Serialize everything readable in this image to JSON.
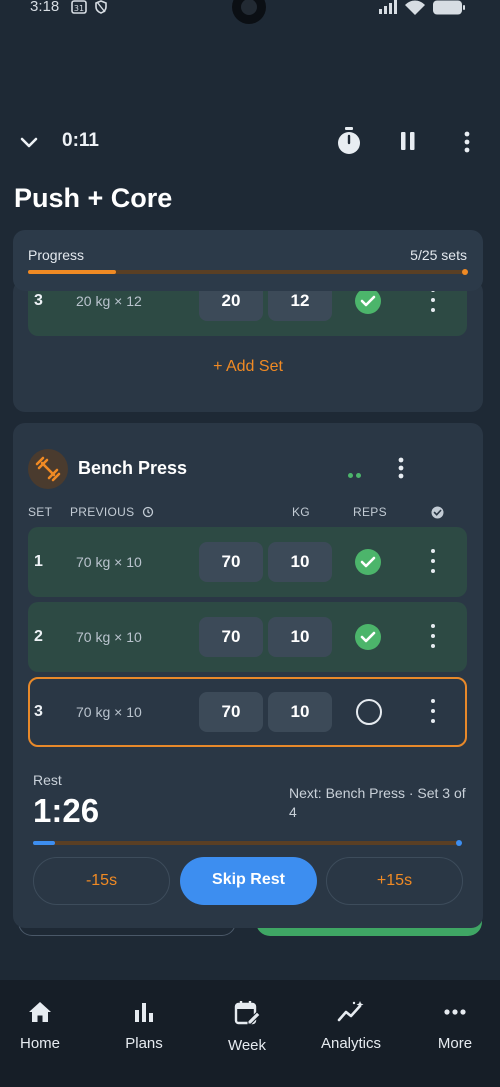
{
  "status": {
    "time": "3:18",
    "calendar_day": "31"
  },
  "header": {
    "timer": "0:11"
  },
  "title": "Push + Core",
  "progress": {
    "label": "Progress",
    "count": "5/25 sets",
    "fraction": 0.2
  },
  "prev_card": {
    "last_set": {
      "num": "3",
      "prev": "20 kg × 12",
      "kg": "20",
      "reps": "12"
    },
    "add_set_label": "+ Add Set"
  },
  "exercise": {
    "name": "Bench Press",
    "columns": {
      "set": "SET",
      "previous": "PREVIOUS",
      "kg": "KG",
      "reps": "REPS"
    },
    "sets": [
      {
        "num": "1",
        "prev": "70 kg × 10",
        "kg": "70",
        "reps": "10",
        "done": true
      },
      {
        "num": "2",
        "prev": "70 kg × 10",
        "kg": "70",
        "reps": "10",
        "done": true
      },
      {
        "num": "3",
        "prev": "70 kg × 10",
        "kg": "70",
        "reps": "10",
        "done": false
      }
    ]
  },
  "rest": {
    "label": "Rest",
    "time": "1:26",
    "next": "Next: Bench Press · Set 3 of 4",
    "minus_label": "-15s",
    "skip_label": "Skip Rest",
    "plus_label": "+15s"
  },
  "nav": {
    "home": "Home",
    "plans": "Plans",
    "week": "Week",
    "analytics": "Analytics",
    "more": "More"
  },
  "colors": {
    "accent": "#f08a24",
    "primary": "#3d8ef0",
    "success": "#4cb56b",
    "background": "#1e2935",
    "card": "#2a3745"
  }
}
